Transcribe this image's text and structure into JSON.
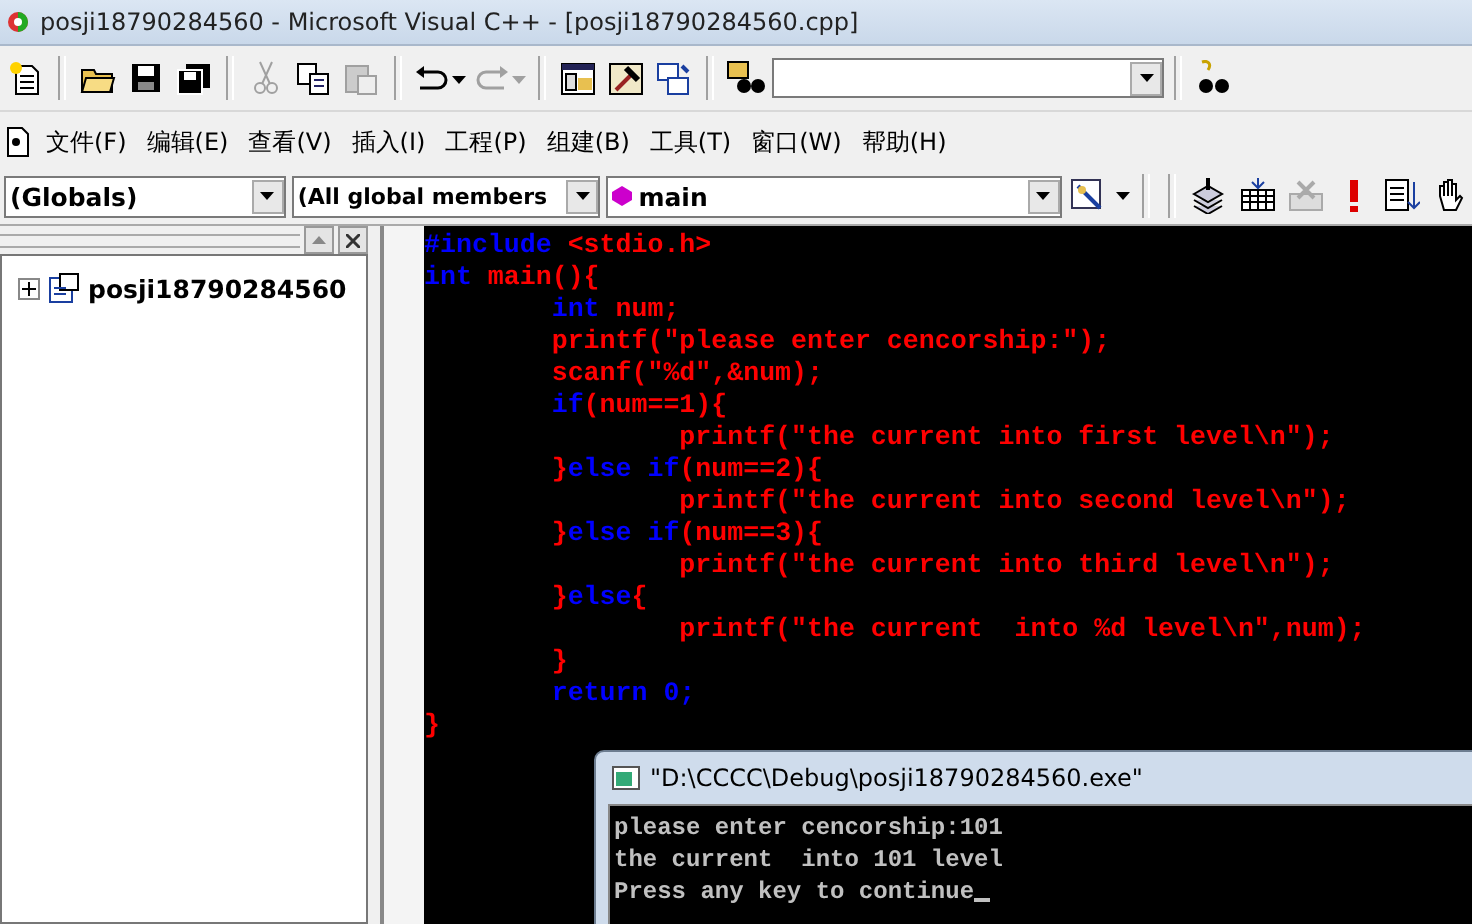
{
  "window": {
    "title": "posji18790284560 - Microsoft Visual C++ - [posji18790284560.cpp]"
  },
  "toolbar": [
    {
      "kind": "cut",
      "disabled": true
    },
    {
      "kind": "copy",
      "disabled": false
    },
    {
      "kind": "paste",
      "disabled": true
    },
    {
      "kind": "undo",
      "disabled": false
    },
    {
      "kind": "redo",
      "disabled": true
    }
  ],
  "menu": [
    "文件(F)",
    "编辑(E)",
    "查看(V)",
    "插入(I)",
    "工程(P)",
    "组建(B)",
    "工具(T)",
    "窗口(W)",
    "帮助(H)"
  ],
  "wizard_bar": {
    "class": "(Globals)",
    "filter": "(All global members",
    "member": "main"
  },
  "workspace": {
    "items": [
      {
        "label": "posji18790284560",
        "expanded": false
      }
    ]
  },
  "code": [
    [
      {
        "text": "#include ",
        "kind": "keyword"
      },
      {
        "text": "<stdio.h>",
        "kind": "plain"
      }
    ],
    [
      {
        "text": "int ",
        "kind": "keyword"
      },
      {
        "text": "main(){",
        "kind": "plain"
      }
    ],
    [
      {
        "text": "        int ",
        "kind": "keyword"
      },
      {
        "text": "num;",
        "kind": "plain"
      }
    ],
    [
      {
        "text": "        printf(\"please enter cencorship:\");",
        "kind": "plain"
      }
    ],
    [
      {
        "text": "        scanf(\"%d\",&num);",
        "kind": "plain"
      }
    ],
    [
      {
        "text": "        if",
        "kind": "keyword"
      },
      {
        "text": "(num==1){",
        "kind": "plain"
      }
    ],
    [
      {
        "text": "                printf(\"the current into first level\\n\");",
        "kind": "plain"
      }
    ],
    [
      {
        "text": "        }",
        "kind": "plain"
      },
      {
        "text": "else if",
        "kind": "keyword"
      },
      {
        "text": "(num==2){",
        "kind": "plain"
      }
    ],
    [
      {
        "text": "                printf(\"the current into second level\\n\");",
        "kind": "plain"
      }
    ],
    [
      {
        "text": "        }",
        "kind": "plain"
      },
      {
        "text": "else if",
        "kind": "keyword"
      },
      {
        "text": "(num==3){",
        "kind": "plain"
      }
    ],
    [
      {
        "text": "                printf(\"the current into third level\\n\");",
        "kind": "plain"
      }
    ],
    [
      {
        "text": "        }",
        "kind": "plain"
      },
      {
        "text": "else",
        "kind": "keyword"
      },
      {
        "text": "{",
        "kind": "plain"
      }
    ],
    [
      {
        "text": "                printf(\"the current  into %d level\\n\",num);",
        "kind": "plain"
      }
    ],
    [
      {
        "text": "        }",
        "kind": "plain"
      }
    ],
    [
      {
        "text": "        return 0;",
        "kind": "keyword"
      }
    ],
    [
      {
        "text": "}",
        "kind": "plain"
      }
    ]
  ],
  "console": {
    "title": "\"D:\\CCCC\\Debug\\posji18790284560.exe\"",
    "lines": [
      "please enter cencorship:101",
      "the current  into 101 level",
      "Press any key to continue"
    ]
  }
}
